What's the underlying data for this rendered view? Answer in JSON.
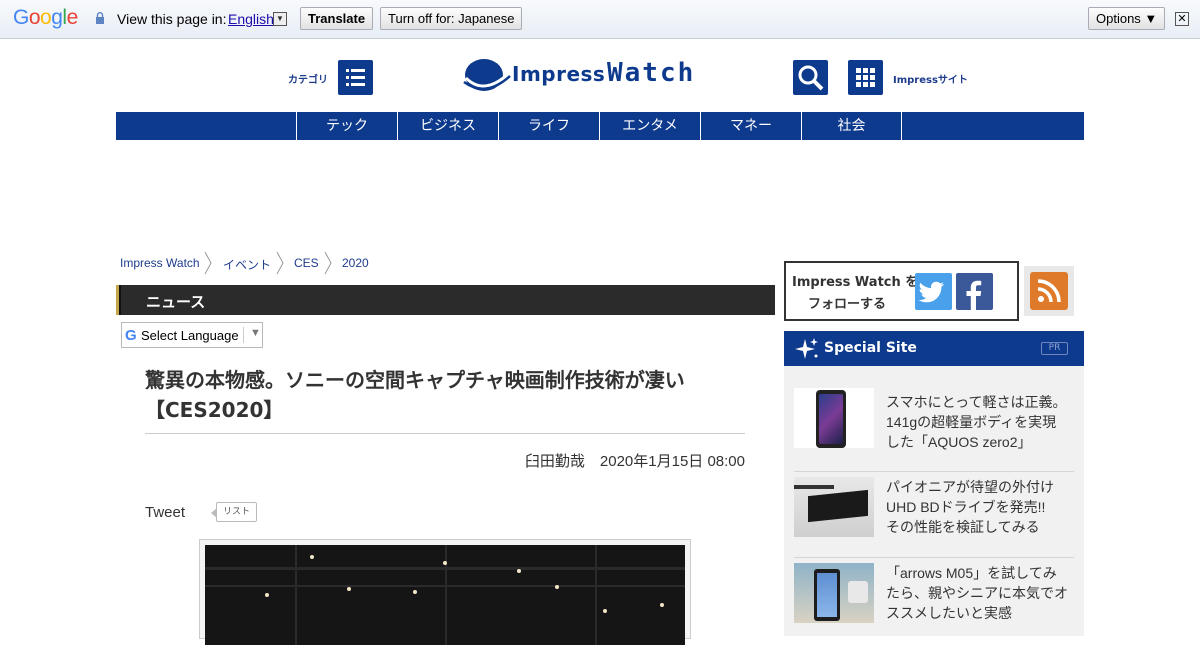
{
  "translate_bar": {
    "google_logo": "Google",
    "prompt": "View this page in:",
    "language": "English",
    "translate_button": "Translate",
    "turn_off_button": "Turn off for: Japanese",
    "options_button": "Options ▼",
    "close_glyph": "✕"
  },
  "header": {
    "category_label": "カテゴリ",
    "logo_text_1": "Impress",
    "logo_text_2": "Watch",
    "impress_site_label": "Impressサイト"
  },
  "nav": {
    "items": [
      "テック",
      "ビジネス",
      "ライフ",
      "エンタメ",
      "マネー",
      "社会"
    ]
  },
  "breadcrumb": [
    "Impress Watch",
    "イベント",
    "CES",
    "2020"
  ],
  "section_title": "ニュース",
  "language_selector": {
    "g": "G",
    "label": "Select Language",
    "arrow": "▼"
  },
  "article": {
    "headline_line1": "驚異の本物感。ソニーの空間キャプチャ映画制作技術が凄い",
    "headline_line2": "【CES2020】",
    "author": "臼田勤哉",
    "date": "2020年1月15日 08:00",
    "tweet_label": "Tweet",
    "list_label": "リスト"
  },
  "sidebar": {
    "follow_line1": "Impress Watch を",
    "follow_line2": "フォローする",
    "special_site_title": "Special Site",
    "pr_label": "PR",
    "items": [
      {
        "lines": [
          "スマホにとって軽さは正義。",
          "141gの超軽量ボディを実現",
          "した「AQUOS zero2」"
        ]
      },
      {
        "lines": [
          "パイオニアが待望の外付け",
          "UHD BDドライブを発売!!",
          "その性能を検証してみる"
        ]
      },
      {
        "lines": [
          "「arrows M05」を試してみ",
          "たら、親やシニアに本気でオ",
          "ススメしたいと実感"
        ]
      }
    ]
  },
  "colors": {
    "brand_blue": "#0e3a8e",
    "twitter": "#4aa1eb",
    "facebook": "#3b5998",
    "rss": "#e07a2b"
  }
}
